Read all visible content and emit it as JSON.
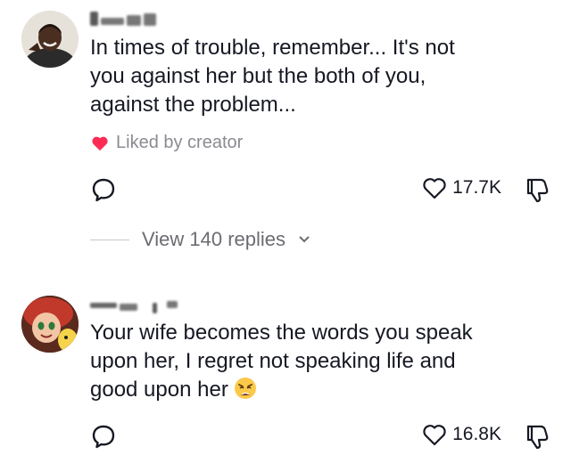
{
  "comments": [
    {
      "text": "In times of trouble, remember... It's not\nyou against her but the both of you,\nagainst the problem...",
      "liked_by": "Liked by creator",
      "likes": "17.7K",
      "view_replies": "View 140 replies",
      "avatar_icon": "person-photo-avatar"
    },
    {
      "text": "Your wife becomes the words you speak\nupon her, I regret not speaking life and\ngood upon her",
      "likes": "16.8K",
      "emoji": "weary-face-emoji",
      "avatar_icon": "cartoon-cowgirl-avatar"
    }
  ],
  "colors": {
    "heart": "#fe2c55",
    "text": "#161823",
    "muted": "#8a8b91"
  }
}
